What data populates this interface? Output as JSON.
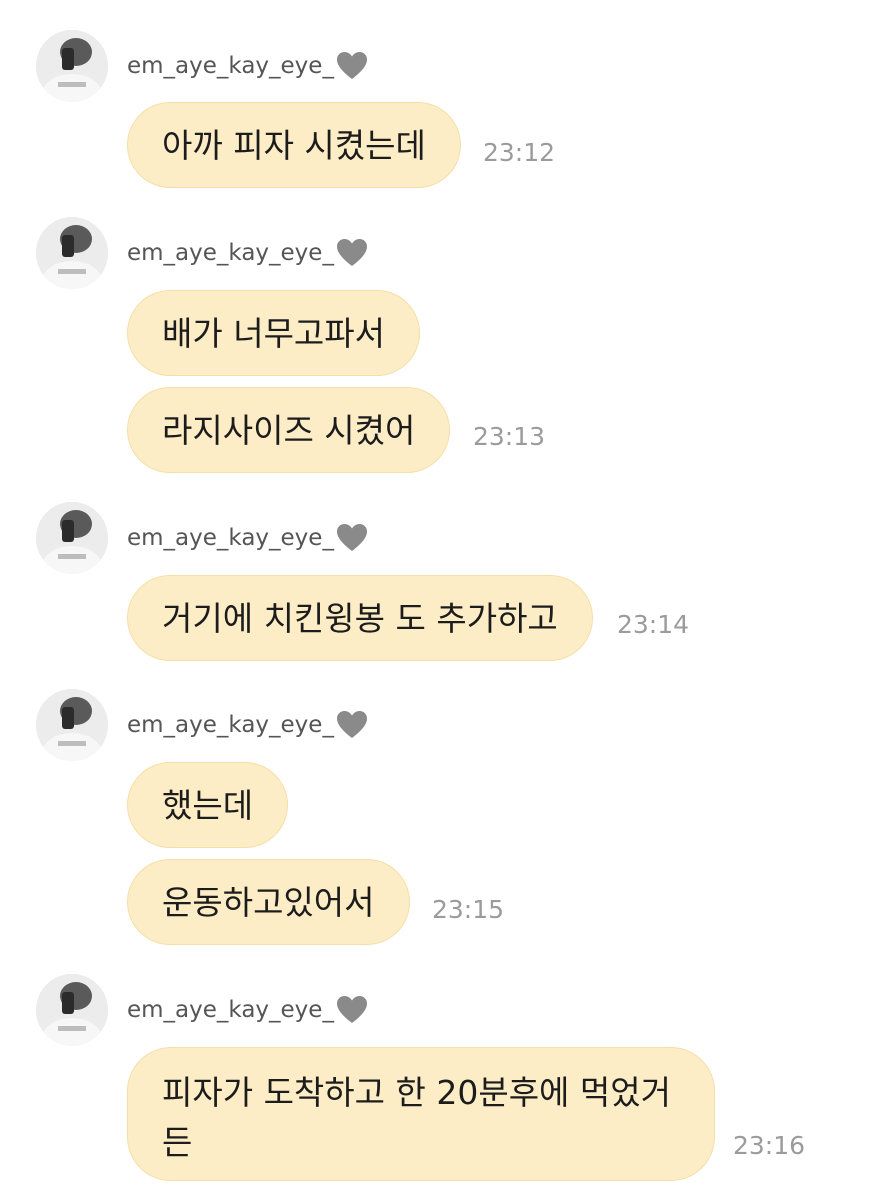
{
  "messages": [
    {
      "sender": "em_aye_kay_eye_",
      "bubbles": [
        "아까 피자 시켰는데"
      ],
      "time": "23:12"
    },
    {
      "sender": "em_aye_kay_eye_",
      "bubbles": [
        "배가 너무고파서",
        "라지사이즈 시켰어"
      ],
      "time": "23:13"
    },
    {
      "sender": "em_aye_kay_eye_",
      "bubbles": [
        "거기에 치킨윙봉 도 추가하고"
      ],
      "time": "23:14"
    },
    {
      "sender": "em_aye_kay_eye_",
      "bubbles": [
        "했는데",
        "운동하고있어서"
      ],
      "time": "23:15"
    },
    {
      "sender": "em_aye_kay_eye_",
      "bubbles": [
        "피자가 도착하고 한 20분후에 먹었거든"
      ],
      "time": "23:16"
    }
  ],
  "colors": {
    "bubble_bg": "#fdedc6",
    "heart": "#8a8a8a",
    "time": "#9b9b9b"
  },
  "icons": {
    "avatar": "profile-photo",
    "sender_badge": "grey-heart-icon"
  }
}
